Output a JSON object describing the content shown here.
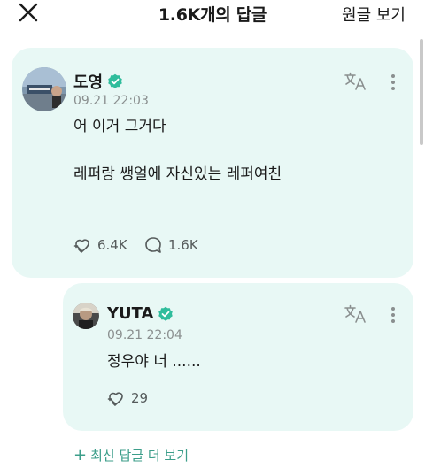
{
  "header": {
    "title": "1.6K개의 답글",
    "view_original": "원글 보기"
  },
  "comment": {
    "username": "도영",
    "timestamp": "09.21 22:03",
    "body": "어 이거 그거다\n\n레퍼랑 쌩얼에 자신있는 레퍼여친",
    "likes": "6.4K",
    "replies": "1.6K"
  },
  "reply": {
    "username": "YUTA",
    "timestamp": "09.21 22:04",
    "body": "정우야 너 ......",
    "likes": "29"
  },
  "more_replies": {
    "label": "최신 답글 더 보기"
  },
  "colors": {
    "card_bg": "#e8f8f5",
    "verified": "#2fbd9c",
    "accent": "#3c9e8a"
  },
  "icons": [
    "close-icon",
    "verified-icon",
    "translate-icon",
    "more-vertical-icon",
    "like-icon",
    "comment-icon",
    "plus-icon"
  ]
}
